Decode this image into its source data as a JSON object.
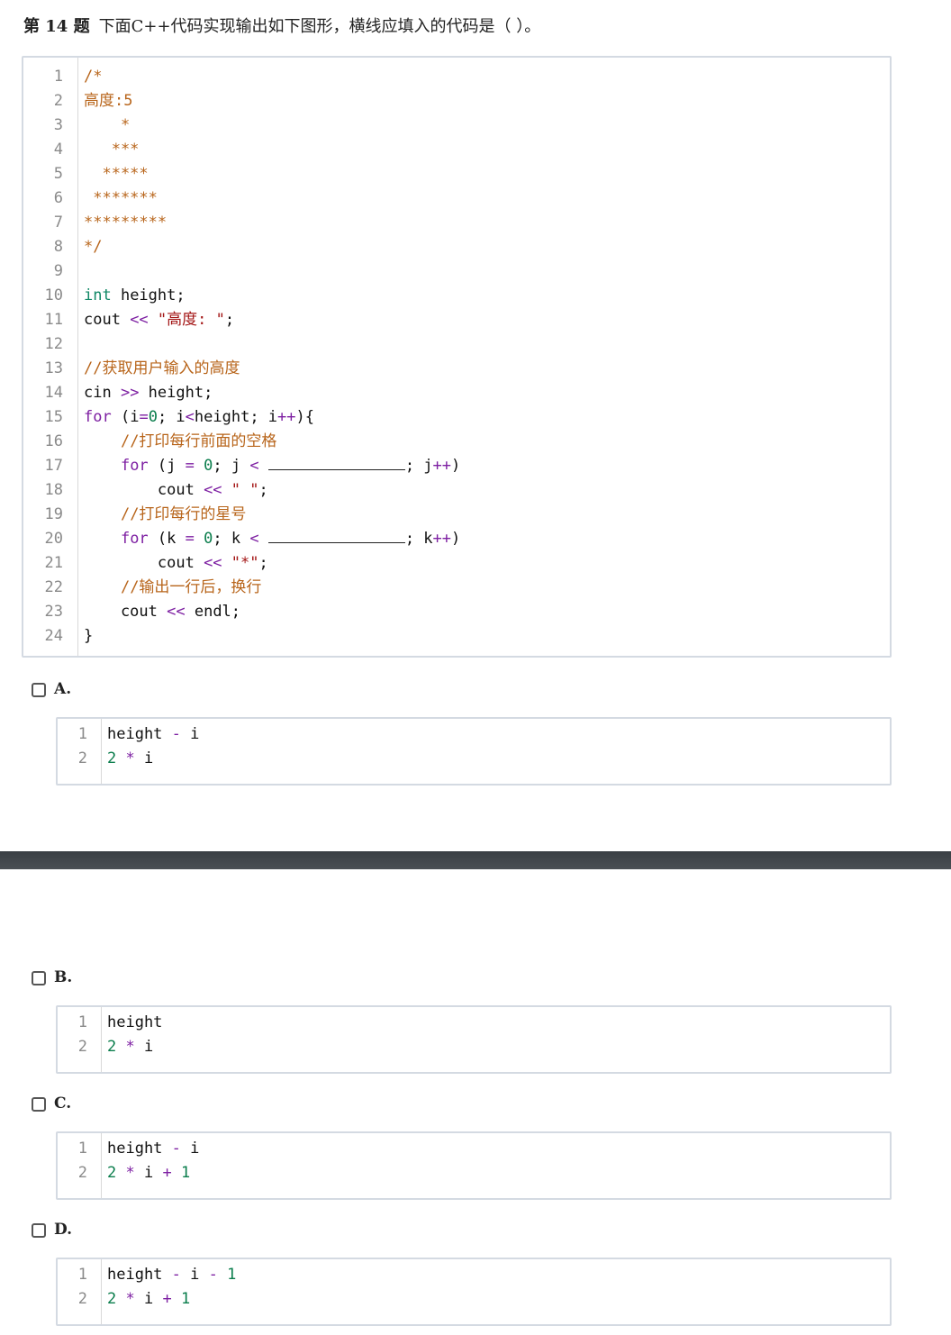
{
  "question": {
    "number": "第 14 题",
    "text": "下面C++代码实现输出如下图形，横线应填入的代码是（   ）。"
  },
  "main_code": {
    "lines": [
      {
        "n": "1",
        "tokens": [
          [
            "com",
            "/*"
          ]
        ]
      },
      {
        "n": "2",
        "tokens": [
          [
            "com",
            "高度:5"
          ]
        ]
      },
      {
        "n": "3",
        "tokens": [
          [
            "com",
            "    *"
          ]
        ]
      },
      {
        "n": "4",
        "tokens": [
          [
            "com",
            "   ***"
          ]
        ]
      },
      {
        "n": "5",
        "tokens": [
          [
            "com",
            "  *****"
          ]
        ]
      },
      {
        "n": "6",
        "tokens": [
          [
            "com",
            " *******"
          ]
        ]
      },
      {
        "n": "7",
        "tokens": [
          [
            "com",
            "*********"
          ]
        ]
      },
      {
        "n": "8",
        "tokens": [
          [
            "com",
            "*/"
          ]
        ]
      },
      {
        "n": "9",
        "tokens": []
      },
      {
        "n": "10",
        "tokens": [
          [
            "type",
            "int"
          ],
          [
            "",
            " height;"
          ]
        ]
      },
      {
        "n": "11",
        "tokens": [
          [
            "",
            "cout "
          ],
          [
            "op",
            "<<"
          ],
          [
            "",
            " "
          ],
          [
            "str",
            "\"高度: \""
          ],
          [
            "",
            ";"
          ]
        ]
      },
      {
        "n": "12",
        "tokens": []
      },
      {
        "n": "13",
        "tokens": [
          [
            "com",
            "//获取用户输入的高度"
          ]
        ]
      },
      {
        "n": "14",
        "tokens": [
          [
            "",
            "cin "
          ],
          [
            "op",
            ">>"
          ],
          [
            "",
            " height;"
          ]
        ]
      },
      {
        "n": "15",
        "tokens": [
          [
            "kw",
            "for"
          ],
          [
            "",
            " (i"
          ],
          [
            "op",
            "="
          ],
          [
            "num",
            "0"
          ],
          [
            "",
            "; i"
          ],
          [
            "op",
            "<"
          ],
          [
            "",
            "height; i"
          ],
          [
            "op",
            "++"
          ],
          [
            "",
            "){"
          ]
        ]
      },
      {
        "n": "16",
        "tokens": [
          [
            "",
            "    "
          ],
          [
            "com",
            "//打印每行前面的空格"
          ]
        ]
      },
      {
        "n": "17",
        "tokens": [
          [
            "",
            "    "
          ],
          [
            "kw",
            "for"
          ],
          [
            "",
            " (j "
          ],
          [
            "op",
            "="
          ],
          [
            "",
            " "
          ],
          [
            "num",
            "0"
          ],
          [
            "",
            "; j "
          ],
          [
            "op",
            "<"
          ],
          [
            "",
            " "
          ],
          [
            "blank",
            ""
          ],
          [
            "",
            "; j"
          ],
          [
            "op",
            "++"
          ],
          [
            "",
            ")"
          ]
        ]
      },
      {
        "n": "18",
        "tokens": [
          [
            "",
            "        cout "
          ],
          [
            "op",
            "<<"
          ],
          [
            "",
            " "
          ],
          [
            "str",
            "\" \""
          ],
          [
            "",
            ";"
          ]
        ]
      },
      {
        "n": "19",
        "tokens": [
          [
            "",
            "    "
          ],
          [
            "com",
            "//打印每行的星号"
          ]
        ]
      },
      {
        "n": "20",
        "tokens": [
          [
            "",
            "    "
          ],
          [
            "kw",
            "for"
          ],
          [
            "",
            " (k "
          ],
          [
            "op",
            "="
          ],
          [
            "",
            " "
          ],
          [
            "num",
            "0"
          ],
          [
            "",
            "; k "
          ],
          [
            "op",
            "<"
          ],
          [
            "",
            " "
          ],
          [
            "blank",
            ""
          ],
          [
            "",
            "; k"
          ],
          [
            "op",
            "++"
          ],
          [
            "",
            ")"
          ]
        ]
      },
      {
        "n": "21",
        "tokens": [
          [
            "",
            "        cout "
          ],
          [
            "op",
            "<<"
          ],
          [
            "",
            " "
          ],
          [
            "str",
            "\"*\""
          ],
          [
            "",
            ";"
          ]
        ]
      },
      {
        "n": "22",
        "tokens": [
          [
            "",
            "    "
          ],
          [
            "com",
            "//输出一行后，换行"
          ]
        ]
      },
      {
        "n": "23",
        "tokens": [
          [
            "",
            "    cout "
          ],
          [
            "op",
            "<<"
          ],
          [
            "",
            " endl;"
          ]
        ]
      },
      {
        "n": "24",
        "tokens": [
          [
            "",
            "}"
          ]
        ]
      }
    ]
  },
  "options": [
    {
      "label": "A.",
      "lines": [
        {
          "n": "1",
          "tokens": [
            [
              "",
              "height "
            ],
            [
              "op",
              "-"
            ],
            [
              "",
              " i"
            ]
          ]
        },
        {
          "n": "2",
          "tokens": [
            [
              "num",
              "2"
            ],
            [
              "",
              " "
            ],
            [
              "op",
              "*"
            ],
            [
              "",
              " i"
            ]
          ]
        }
      ]
    },
    {
      "label": "B.",
      "lines": [
        {
          "n": "1",
          "tokens": [
            [
              "",
              "height"
            ]
          ]
        },
        {
          "n": "2",
          "tokens": [
            [
              "num",
              "2"
            ],
            [
              "",
              " "
            ],
            [
              "op",
              "*"
            ],
            [
              "",
              " i"
            ]
          ]
        }
      ]
    },
    {
      "label": "C.",
      "lines": [
        {
          "n": "1",
          "tokens": [
            [
              "",
              "height "
            ],
            [
              "op",
              "-"
            ],
            [
              "",
              " i"
            ]
          ]
        },
        {
          "n": "2",
          "tokens": [
            [
              "num",
              "2"
            ],
            [
              "",
              " "
            ],
            [
              "op",
              "*"
            ],
            [
              "",
              " i "
            ],
            [
              "op",
              "+"
            ],
            [
              "",
              " "
            ],
            [
              "num",
              "1"
            ]
          ]
        }
      ]
    },
    {
      "label": "D.",
      "lines": [
        {
          "n": "1",
          "tokens": [
            [
              "",
              "height "
            ],
            [
              "op",
              "-"
            ],
            [
              "",
              " i "
            ],
            [
              "op",
              "-"
            ],
            [
              "",
              " "
            ],
            [
              "num",
              "1"
            ]
          ]
        },
        {
          "n": "2",
          "tokens": [
            [
              "num",
              "2"
            ],
            [
              "",
              " "
            ],
            [
              "op",
              "*"
            ],
            [
              "",
              " i "
            ],
            [
              "op",
              "+"
            ],
            [
              "",
              " "
            ],
            [
              "num",
              "1"
            ]
          ]
        }
      ]
    }
  ]
}
